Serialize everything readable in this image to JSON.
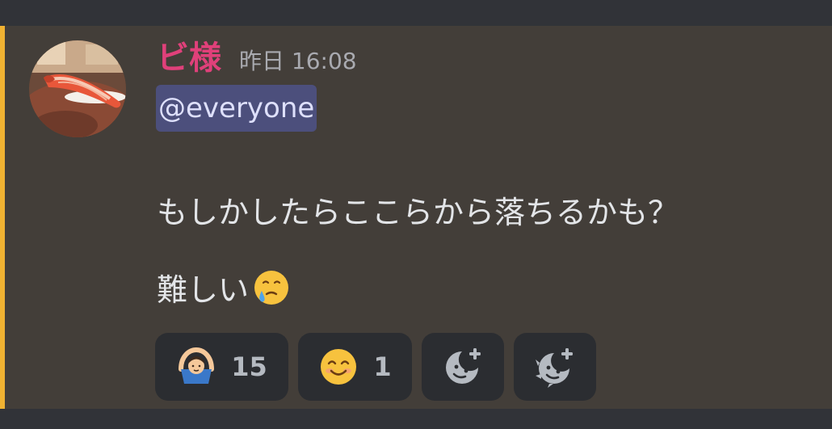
{
  "message": {
    "author_name": "ビ様",
    "author_color": "#e0407a",
    "timestamp": "昨日 16:08",
    "mention": "@everyone",
    "line1": "もしかしたらここらから落ちるかも？",
    "line2_text": "難しい",
    "line2_emoji": "face-holding-back-tears",
    "highlight_color": "#f0b232"
  },
  "reactions": [
    {
      "emoji": "person-gesturing-ok",
      "count": "15"
    },
    {
      "emoji": "smiling-face-with-smiling-eyes",
      "count": "1"
    },
    {
      "emoji": "add-reaction-icon",
      "count": ""
    },
    {
      "emoji": "add-super-reaction-icon",
      "count": ""
    }
  ]
}
